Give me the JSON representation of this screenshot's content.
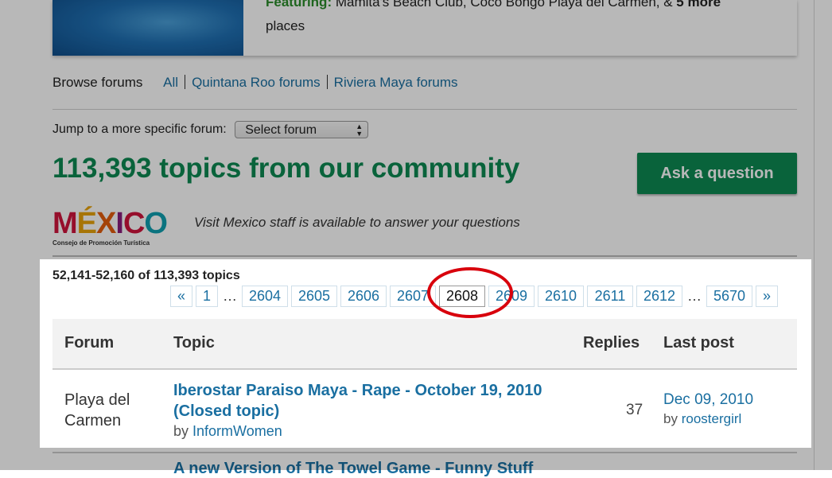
{
  "promo": {
    "featuring_label": "Featuring:",
    "featuring_text": " Mamita's Beach Club, Coco Bongo Playa del Carmen, & ",
    "more_label": "5 more",
    "line2": "places"
  },
  "browse": {
    "label": "Browse forums",
    "links": [
      "All",
      "Quintana Roo forums",
      "Riviera Maya forums"
    ]
  },
  "jump": {
    "label": "Jump to a more specific forum:",
    "select_value": "Select forum"
  },
  "headline": "113,393 topics from our community",
  "ask_button": "Ask a question",
  "sponsor": {
    "logo_word": "MÉXICO",
    "logo_sub": "Consejo de Promoción Turística",
    "staff_note": "Visit Mexico staff is available to answer your questions"
  },
  "topic_count": "52,141-52,160 of 113,393 topics",
  "pager": {
    "prev": "«",
    "first": "1",
    "ellipsis": "…",
    "pages": [
      "2604",
      "2605",
      "2606",
      "2607",
      "2608",
      "2609",
      "2610",
      "2611",
      "2612"
    ],
    "current": "2608",
    "last": "5670",
    "next": "»"
  },
  "table": {
    "headers": {
      "forum": "Forum",
      "topic": "Topic",
      "replies": "Replies",
      "last_post": "Last post"
    },
    "rows": [
      {
        "forum": "Playa del Carmen",
        "topic": "Iberostar Paraiso Maya - Rape - October 19, 2010 (Closed topic)",
        "by_label": "by",
        "author": "InformWomen",
        "replies": "37",
        "last_date": "Dec 09, 2010",
        "last_by_label": "by",
        "last_author": "roostergirl"
      }
    ],
    "next_topic_partial": "A new Version of The Towel Game - Funny Stuff"
  },
  "colors": {
    "accent_green": "#0d8a52",
    "link_blue": "#1a6fa1",
    "highlight_circle": "#d8000c"
  }
}
